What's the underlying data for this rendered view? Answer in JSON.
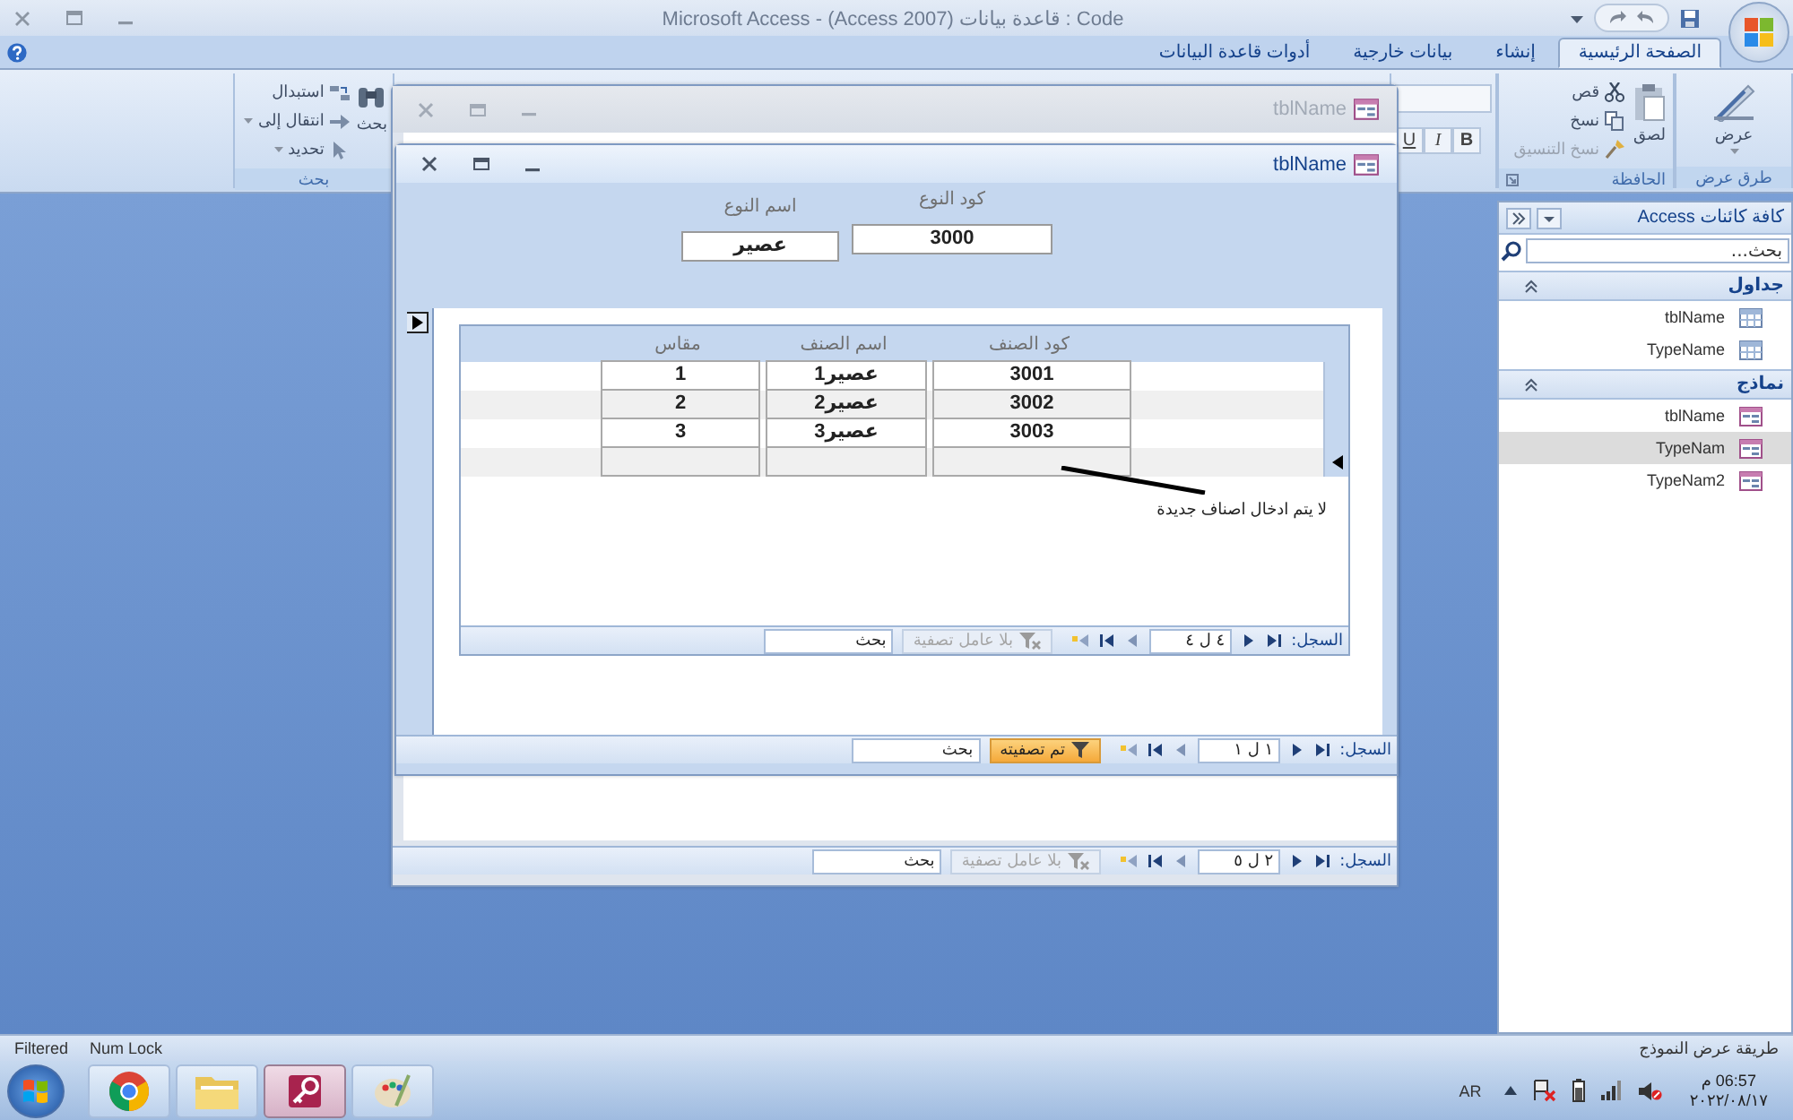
{
  "window": {
    "title": "Code : قاعدة بيانات (Access 2007) - Microsoft Access"
  },
  "tabs": [
    {
      "label": "الصفحة الرئيسية",
      "selected": true
    },
    {
      "label": "إنشاء",
      "selected": false
    },
    {
      "label": "بيانات خارجية",
      "selected": false
    },
    {
      "label": "أدوات قاعدة البيانات",
      "selected": false
    }
  ],
  "ribbon": {
    "views": {
      "label": "طرق عرض",
      "button": "عرض"
    },
    "clipboard": {
      "label": "الحافظة",
      "paste": "لصق",
      "buttons": [
        {
          "label": "قص",
          "kind": "cut",
          "disabled": false
        },
        {
          "label": "نسخ",
          "kind": "copy",
          "disabled": false
        },
        {
          "label": "نسخ التنسيق",
          "kind": "brush",
          "disabled": true
        }
      ]
    },
    "font": {
      "buttons": [
        "B",
        "I",
        "U"
      ]
    },
    "find": {
      "label": "بحث",
      "button": "بحث",
      "buttons": [
        {
          "label": "استبدال",
          "kind": "replace",
          "dropdown": false
        },
        {
          "label": "انتقال إلى",
          "kind": "goto",
          "dropdown": true
        },
        {
          "label": "تحديد",
          "kind": "select",
          "dropdown": true
        }
      ]
    }
  },
  "forms": [
    {
      "title": "tblName",
      "active": false,
      "record_nav": {
        "label": "السجل:",
        "position": "٢ ل ٥",
        "filter": "بلا عامل تصفية",
        "filtered": false,
        "search_placeholder": "بحث"
      }
    },
    {
      "title": "tblName",
      "active": true,
      "current_record": true,
      "header_fields": [
        {
          "label": "كود النوع",
          "value": "3000"
        },
        {
          "label": "اسم النوع",
          "value": "عصير"
        }
      ],
      "subform": {
        "columns": [
          "كود الصنف",
          "اسم الصنف",
          "مقاس"
        ],
        "rows": [
          [
            "3001",
            "عصير1",
            "1"
          ],
          [
            "3002",
            "عصير2",
            "2"
          ],
          [
            "3003",
            "عصير3",
            "3"
          ]
        ],
        "new_row_current": true,
        "annotation": "لا يتم ادخال اصناف جديدة",
        "record_nav": {
          "label": "السجل:",
          "position": "٤ ل ٤",
          "filter": "بلا عامل تصفية",
          "filtered": false,
          "search_placeholder": "بحث"
        }
      },
      "record_nav": {
        "label": "السجل:",
        "position": "١ ل ١",
        "filter": "تم تصفيته",
        "filtered": true,
        "search_placeholder": "بحث"
      }
    }
  ],
  "navigation_pane": {
    "title": "كافة كائنات Access",
    "search_placeholder": "بحث...",
    "groups": [
      {
        "name": "جداول",
        "items": [
          {
            "label": "tblName",
            "kind": "table",
            "selected": false
          },
          {
            "label": "TypeName",
            "kind": "table",
            "selected": false
          }
        ]
      },
      {
        "name": "نماذج",
        "items": [
          {
            "label": "tblName",
            "kind": "form",
            "selected": false
          },
          {
            "label": "TypeNam",
            "kind": "form",
            "selected": true
          },
          {
            "label": "TypeNam2",
            "kind": "form",
            "selected": false
          }
        ]
      }
    ]
  },
  "status_bar": {
    "left": [
      "Num Lock",
      "Filtered"
    ],
    "right": "طريقة عرض النموذج"
  },
  "taskbar": {
    "apps": [
      {
        "kind": "chrome",
        "selected": false
      },
      {
        "kind": "folder",
        "selected": false
      },
      {
        "kind": "access",
        "selected": true
      },
      {
        "kind": "paint",
        "selected": false
      }
    ],
    "language": "AR",
    "time": "06:57 م",
    "date": "٢٠٢٢/٠٨/١٧"
  }
}
